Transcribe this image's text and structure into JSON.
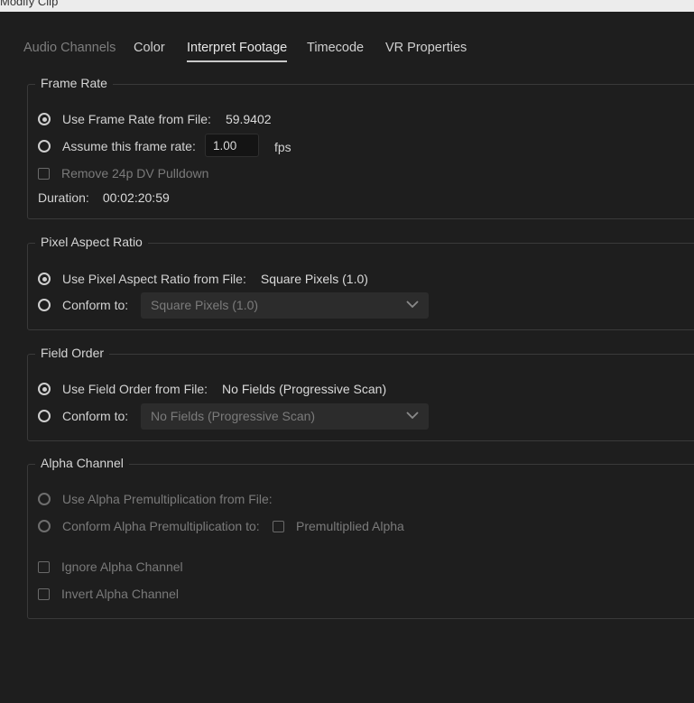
{
  "window": {
    "title": "Modify Clip"
  },
  "tabs": [
    {
      "label": "Audio Channels",
      "enabled": false
    },
    {
      "label": "Color",
      "enabled": true
    },
    {
      "label": "Interpret Footage",
      "enabled": true,
      "active": true
    },
    {
      "label": "Timecode",
      "enabled": true
    },
    {
      "label": "VR Properties",
      "enabled": true
    }
  ],
  "frame_rate": {
    "legend": "Frame Rate",
    "use_from_file_label": "Use Frame Rate from File:",
    "file_value": "59.9402",
    "assume_label": "Assume this frame rate:",
    "assume_value": "1.00",
    "fps_label": "fps",
    "pulldown_label": "Remove 24p DV Pulldown",
    "duration_label": "Duration:",
    "duration_value": "00:02:20:59",
    "selected": "use_from_file"
  },
  "pixel_aspect_ratio": {
    "legend": "Pixel Aspect Ratio",
    "use_from_file_label": "Use Pixel Aspect Ratio from File:",
    "file_value": "Square Pixels (1.0)",
    "conform_label": "Conform to:",
    "conform_value": "Square Pixels (1.0)",
    "selected": "use_from_file"
  },
  "field_order": {
    "legend": "Field Order",
    "use_from_file_label": "Use Field Order from File:",
    "file_value": "No Fields (Progressive Scan)",
    "conform_label": "Conform to:",
    "conform_value": "No Fields (Progressive Scan)",
    "selected": "use_from_file"
  },
  "alpha_channel": {
    "legend": "Alpha Channel",
    "use_from_file_label": "Use Alpha Premultiplication from File:",
    "conform_label": "Conform Alpha Premultiplication to:",
    "premultiplied_label": "Premultiplied Alpha",
    "ignore_label": "Ignore Alpha Channel",
    "invert_label": "Invert Alpha Channel"
  },
  "colors": {
    "background": "#1e1e1e",
    "text": "#cfcfcf",
    "disabled_text": "#7a7a7a",
    "group_border": "#3a3a3a",
    "input_bg": "#141414",
    "select_bg": "#2c2c2c"
  },
  "icons": {
    "dropdown": "chevron-down-icon"
  }
}
